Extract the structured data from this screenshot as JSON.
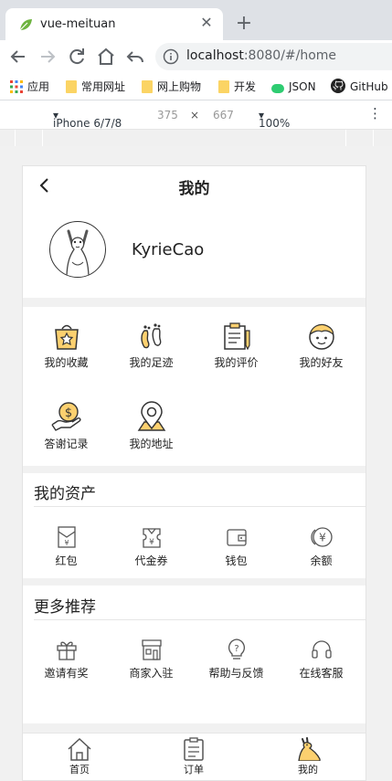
{
  "browser": {
    "tab_title": "vue-meituan",
    "url_host": "localhost",
    "url_path": ":8080/#/home",
    "bookmarks": [
      {
        "label": "应用",
        "icon": "apps-grid-icon"
      },
      {
        "label": "常用网址",
        "icon": "folder-icon"
      },
      {
        "label": "网上购物",
        "icon": "folder-icon"
      },
      {
        "label": "开发",
        "icon": "folder-icon"
      },
      {
        "label": "JSON",
        "icon": "json-icon"
      },
      {
        "label": "GitHub",
        "icon": "github-icon"
      }
    ],
    "device": "iPhone 6/7/8",
    "width": "375",
    "height": "667",
    "zoom": "100%",
    "times": "×"
  },
  "page": {
    "title": "我的",
    "username": "KyrieCao",
    "shortcuts": [
      {
        "label": "我的收藏",
        "icon": "favorite-bag-icon"
      },
      {
        "label": "我的足迹",
        "icon": "footprints-icon"
      },
      {
        "label": "我的评价",
        "icon": "review-clipboard-icon"
      },
      {
        "label": "我的好友",
        "icon": "friend-face-icon"
      },
      {
        "label": "答谢记录",
        "icon": "thanks-coin-hand-icon"
      },
      {
        "label": "我的地址",
        "icon": "location-pin-icon"
      }
    ],
    "assets_title": "我的资产",
    "assets": [
      {
        "label": "红包",
        "icon": "red-envelope-icon"
      },
      {
        "label": "代金券",
        "icon": "voucher-icon"
      },
      {
        "label": "钱包",
        "icon": "wallet-icon"
      },
      {
        "label": "余额",
        "icon": "balance-coin-icon"
      }
    ],
    "more_title": "更多推荐",
    "more": [
      {
        "label": "邀请有奖",
        "icon": "gift-icon"
      },
      {
        "label": "商家入驻",
        "icon": "shop-icon"
      },
      {
        "label": "帮助与反馈",
        "icon": "help-bulb-icon"
      },
      {
        "label": "在线客服",
        "icon": "headset-icon"
      }
    ],
    "tabbar": [
      {
        "label": "首页",
        "icon": "home-icon"
      },
      {
        "label": "订单",
        "icon": "order-icon"
      },
      {
        "label": "我的",
        "icon": "kangaroo-icon",
        "active": true
      }
    ]
  },
  "colors": {
    "accent_yellow": "#fcd06f",
    "line": "#333333"
  }
}
